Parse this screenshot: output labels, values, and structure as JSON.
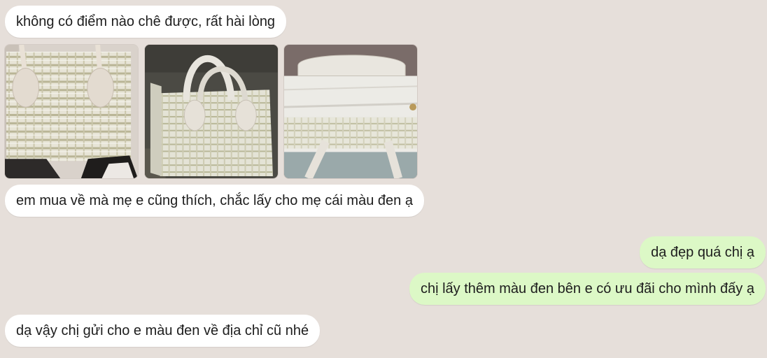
{
  "messages": [
    {
      "text": "không có điểm nào chê được, rất hài lòng"
    },
    {
      "text": "em mua về mà mẹ e cũng thích, chắc lấy cho mẹ cái màu đen ạ"
    },
    {
      "text": "dạ đẹp quá chị ạ"
    },
    {
      "text": "chị lấy thêm màu đen bên e có ưu đãi cho mình đấy ạ"
    },
    {
      "text": "dạ vậy chị gửi cho e màu đen về địa chỉ cũ nhé"
    }
  ],
  "photos": [
    {
      "icon": "handbag-front-photo"
    },
    {
      "icon": "handbag-side-photo"
    },
    {
      "icon": "handbag-open-photo"
    }
  ],
  "colors": {
    "background": "#e6dfda",
    "incoming_bubble": "#ffffff",
    "outgoing_bubble": "#dcf8c6",
    "text": "#1d1d1d"
  }
}
